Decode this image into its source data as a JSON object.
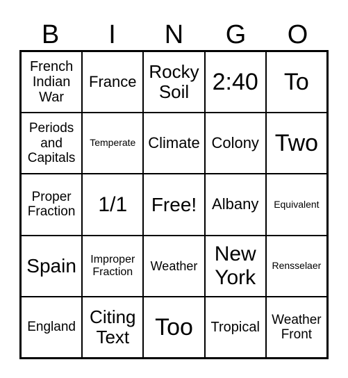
{
  "header": [
    "B",
    "I",
    "N",
    "G",
    "O"
  ],
  "cells": [
    {
      "text": "French Indian War",
      "size": 20
    },
    {
      "text": "France",
      "size": 22
    },
    {
      "text": "Rocky Soil",
      "size": 26
    },
    {
      "text": "2:40",
      "size": 34
    },
    {
      "text": "To",
      "size": 34
    },
    {
      "text": "Periods and Capitals",
      "size": 19
    },
    {
      "text": "Temperate",
      "size": 14
    },
    {
      "text": "Climate",
      "size": 22
    },
    {
      "text": "Colony",
      "size": 22
    },
    {
      "text": "Two",
      "size": 34
    },
    {
      "text": "Proper Fraction",
      "size": 19
    },
    {
      "text": "1/1",
      "size": 30
    },
    {
      "text": "Free!",
      "size": 28
    },
    {
      "text": "Albany",
      "size": 22
    },
    {
      "text": "Equivalent",
      "size": 14
    },
    {
      "text": "Spain",
      "size": 28
    },
    {
      "text": "Improper Fraction",
      "size": 16
    },
    {
      "text": "Weather",
      "size": 18
    },
    {
      "text": "New York",
      "size": 30
    },
    {
      "text": "Rensselaer",
      "size": 14
    },
    {
      "text": "England",
      "size": 19
    },
    {
      "text": "Citing Text",
      "size": 26
    },
    {
      "text": "Too",
      "size": 34
    },
    {
      "text": "Tropical",
      "size": 20
    },
    {
      "text": "Weather Front",
      "size": 19
    }
  ]
}
